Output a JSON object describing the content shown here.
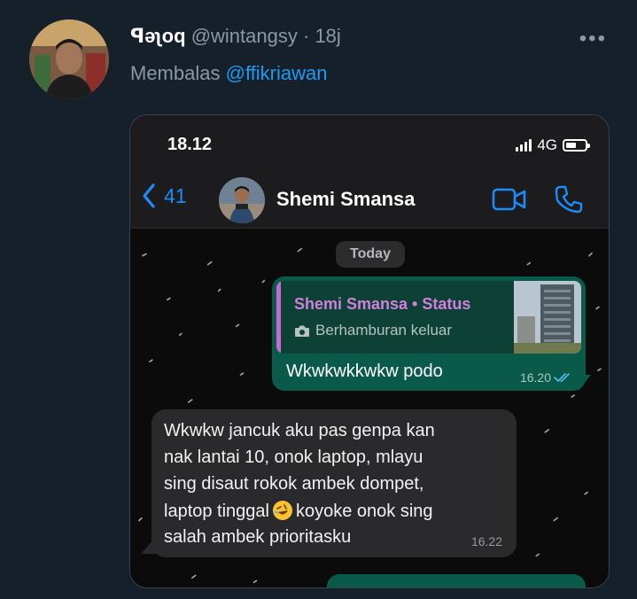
{
  "tweet": {
    "display_name": "ꟼǝʅoq",
    "handle": "@wintangsy",
    "separator": "·",
    "time": "18j",
    "more_icon": "more-icon",
    "reply_prefix": "Membalas",
    "reply_to": "@ffikriawan"
  },
  "phone": {
    "status_time": "18.12",
    "network": "4G",
    "back_count": "41",
    "contact_name": "Shemi Smansa",
    "date_label": "Today",
    "quoted": {
      "author": "Shemi Smansa • Status",
      "caption": "Berhamburan keluar"
    },
    "outgoing": {
      "text": "Wkwkwkkwkw podo",
      "time": "16.20"
    },
    "incoming": {
      "lines": [
        "Wkwkw jancuk aku pas genpa kan",
        "nak lantai 10, onok laptop, mlayu",
        "sing disaut rokok ambek dompet,",
        "laptop tinggal",
        "salah ambek prioritasku"
      ],
      "line4_after_emoji": "koyoke onok sing",
      "time": "16.22"
    }
  },
  "colors": {
    "background": "#15202b",
    "accent": "#1d9bf0",
    "outgoing_bubble": "#0a5a49",
    "incoming_bubble": "#2a2a2c",
    "quote_author": "#d27fe0"
  }
}
